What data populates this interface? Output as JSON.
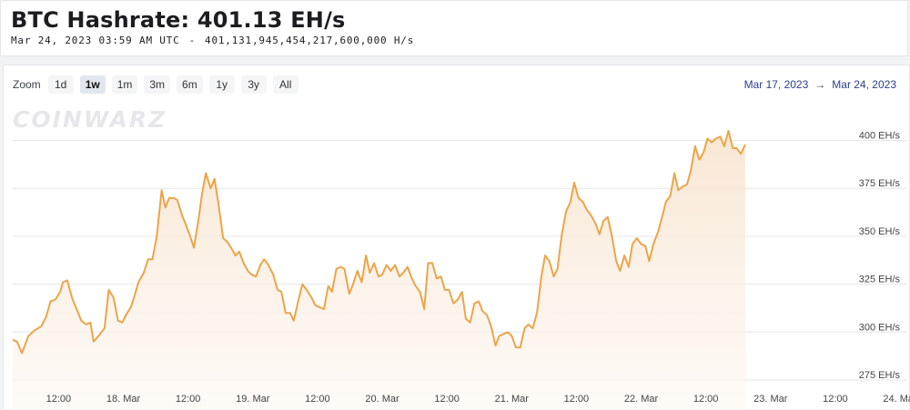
{
  "header": {
    "title": "BTC Hashrate: 401.13 EH/s",
    "timestamp": "Mar 24, 2023 03:59 AM UTC",
    "separator": "-",
    "raw_hashrate": "401,131,945,454,217,600,000 H/s"
  },
  "zoom": {
    "label": "Zoom",
    "options": [
      "1d",
      "1w",
      "1m",
      "3m",
      "6m",
      "1y",
      "3y",
      "All"
    ],
    "active": "1w"
  },
  "range": {
    "from": "Mar 17, 2023",
    "arrow": "→",
    "to": "Mar 24, 2023"
  },
  "watermark": "COINWARZ",
  "colors": {
    "line": "#eaa54a",
    "fill_top": "#f8e6d2",
    "grid": "#e6e6e6",
    "range_text": "#2b3d8f"
  },
  "chart_data": {
    "type": "area",
    "unit": "EH/s",
    "ylim": [
      275,
      405
    ],
    "yticks": [
      {
        "value": 275,
        "label": "275 EH/s"
      },
      {
        "value": 300,
        "label": "300 EH/s"
      },
      {
        "value": 325,
        "label": "325 EH/s"
      },
      {
        "value": 350,
        "label": "350 EH/s"
      },
      {
        "value": 375,
        "label": "375 EH/s"
      },
      {
        "value": 400,
        "label": "400 EH/s"
      }
    ],
    "xlim": [
      -8.5,
      156
    ],
    "xticks": [
      {
        "hour": 0,
        "label": "12:00"
      },
      {
        "hour": 12,
        "label": "18. Mar"
      },
      {
        "hour": 24,
        "label": "12:00"
      },
      {
        "hour": 36,
        "label": "19. Mar"
      },
      {
        "hour": 48,
        "label": "12:00"
      },
      {
        "hour": 60,
        "label": "20. Mar"
      },
      {
        "hour": 72,
        "label": "12:00"
      },
      {
        "hour": 84,
        "label": "21. Mar"
      },
      {
        "hour": 96,
        "label": "12:00"
      },
      {
        "hour": 108,
        "label": "22. Mar"
      },
      {
        "hour": 120,
        "label": "12:00"
      },
      {
        "hour": 132,
        "label": "23. Mar"
      },
      {
        "hour": 144,
        "label": "12:00"
      },
      {
        "hour": 156,
        "label": "24. Mar"
      }
    ],
    "grid": true,
    "legend": false,
    "series": [
      {
        "points": [
          [
            -8.5,
            296
          ],
          [
            -7.7,
            295
          ],
          [
            -6.8,
            289
          ],
          [
            -5.6,
            298
          ],
          [
            -4.4,
            301
          ],
          [
            -3.2,
            303
          ],
          [
            -2.3,
            308
          ],
          [
            -1.5,
            316
          ],
          [
            -0.6,
            317
          ],
          [
            0.3,
            321
          ],
          [
            0.8,
            326
          ],
          [
            1.6,
            327
          ],
          [
            2.6,
            317
          ],
          [
            3.5,
            311
          ],
          [
            4.2,
            306
          ],
          [
            5.1,
            304
          ],
          [
            5.9,
            305
          ],
          [
            6.5,
            295
          ],
          [
            7.7,
            299
          ],
          [
            8.5,
            302
          ],
          [
            9.3,
            322
          ],
          [
            10.2,
            318
          ],
          [
            11.0,
            306
          ],
          [
            11.8,
            305
          ],
          [
            12.5,
            309
          ],
          [
            13.4,
            313
          ],
          [
            14.2,
            320
          ],
          [
            14.8,
            326
          ],
          [
            15.8,
            331
          ],
          [
            16.6,
            338
          ],
          [
            17.4,
            338
          ],
          [
            18.2,
            350
          ],
          [
            19.1,
            374
          ],
          [
            19.8,
            365
          ],
          [
            20.5,
            370
          ],
          [
            21.3,
            370
          ],
          [
            22.0,
            369
          ],
          [
            22.9,
            361
          ],
          [
            23.6,
            356
          ],
          [
            24.4,
            350
          ],
          [
            25.1,
            344
          ],
          [
            25.9,
            358
          ],
          [
            26.6,
            372
          ],
          [
            27.3,
            383
          ],
          [
            28.2,
            375
          ],
          [
            28.9,
            380
          ],
          [
            29.7,
            366
          ],
          [
            30.5,
            349
          ],
          [
            31.3,
            347
          ],
          [
            32.0,
            344
          ],
          [
            32.8,
            340
          ],
          [
            33.5,
            342
          ],
          [
            34.3,
            336
          ],
          [
            35.1,
            332
          ],
          [
            35.8,
            330
          ],
          [
            36.6,
            329
          ],
          [
            37.4,
            335
          ],
          [
            38.1,
            338
          ],
          [
            38.9,
            335
          ],
          [
            39.8,
            330
          ],
          [
            40.6,
            322
          ],
          [
            41.3,
            321
          ],
          [
            42.1,
            310
          ],
          [
            42.9,
            310
          ],
          [
            43.6,
            306
          ],
          [
            44.5,
            317
          ],
          [
            45.2,
            325
          ],
          [
            46.0,
            322
          ],
          [
            46.9,
            318
          ],
          [
            47.6,
            314
          ],
          [
            48.4,
            313
          ],
          [
            49.2,
            312
          ],
          [
            50.0,
            324
          ],
          [
            50.7,
            321
          ],
          [
            51.5,
            333
          ],
          [
            52.3,
            334
          ],
          [
            53.0,
            333
          ],
          [
            53.9,
            320
          ],
          [
            54.6,
            325
          ],
          [
            55.4,
            332
          ],
          [
            56.2,
            326
          ],
          [
            57.0,
            340
          ],
          [
            57.7,
            331
          ],
          [
            58.5,
            336
          ],
          [
            59.3,
            329
          ],
          [
            60.0,
            330
          ],
          [
            60.8,
            335
          ],
          [
            61.6,
            332
          ],
          [
            62.4,
            335
          ],
          [
            63.2,
            329
          ],
          [
            63.9,
            331
          ],
          [
            64.7,
            334
          ],
          [
            65.5,
            328
          ],
          [
            66.2,
            324
          ],
          [
            67.0,
            321
          ],
          [
            67.8,
            312
          ],
          [
            68.5,
            336
          ],
          [
            69.3,
            336
          ],
          [
            70.1,
            328
          ],
          [
            70.9,
            329
          ],
          [
            71.6,
            322
          ],
          [
            72.4,
            322
          ],
          [
            73.2,
            315
          ],
          [
            74.0,
            317
          ],
          [
            74.8,
            321
          ],
          [
            75.5,
            307
          ],
          [
            76.3,
            305
          ],
          [
            77.1,
            315
          ],
          [
            77.9,
            316
          ],
          [
            78.6,
            311
          ],
          [
            79.4,
            309
          ],
          [
            80.2,
            303
          ],
          [
            81.0,
            293
          ],
          [
            81.7,
            298
          ],
          [
            82.5,
            299
          ],
          [
            83.3,
            300
          ],
          [
            84.0,
            298
          ],
          [
            84.8,
            292
          ],
          [
            85.6,
            292
          ],
          [
            86.4,
            302
          ],
          [
            87.1,
            304
          ],
          [
            87.9,
            302
          ],
          [
            88.7,
            310
          ],
          [
            89.5,
            329
          ],
          [
            90.2,
            340
          ],
          [
            91.0,
            337
          ],
          [
            91.8,
            329
          ],
          [
            92.5,
            333
          ],
          [
            93.3,
            351
          ],
          [
            94.1,
            363
          ],
          [
            94.9,
            368
          ],
          [
            95.6,
            378
          ],
          [
            96.4,
            370
          ],
          [
            97.2,
            368
          ],
          [
            97.9,
            364
          ],
          [
            98.7,
            361
          ],
          [
            99.5,
            357
          ],
          [
            100.3,
            351
          ],
          [
            101.0,
            358
          ],
          [
            101.8,
            360
          ],
          [
            102.6,
            350
          ],
          [
            103.4,
            337
          ],
          [
            104.1,
            332
          ],
          [
            104.9,
            340
          ],
          [
            105.7,
            334
          ],
          [
            106.4,
            346
          ],
          [
            107.2,
            349
          ],
          [
            108.0,
            346
          ],
          [
            108.8,
            345
          ],
          [
            109.5,
            337
          ],
          [
            110.3,
            346
          ],
          [
            111.1,
            352
          ],
          [
            111.8,
            359
          ],
          [
            112.6,
            368
          ],
          [
            113.4,
            371
          ],
          [
            114.2,
            383
          ],
          [
            114.9,
            374
          ],
          [
            115.7,
            376
          ],
          [
            116.5,
            377
          ],
          [
            117.2,
            384
          ],
          [
            118.0,
            397
          ],
          [
            118.8,
            390
          ],
          [
            119.6,
            394
          ],
          [
            120.3,
            401
          ],
          [
            121.1,
            399
          ],
          [
            121.9,
            401
          ],
          [
            122.7,
            402
          ],
          [
            123.4,
            397
          ],
          [
            124.2,
            405
          ],
          [
            125.0,
            396
          ],
          [
            125.7,
            396
          ],
          [
            126.5,
            393
          ],
          [
            127.3,
            398
          ]
        ]
      }
    ]
  }
}
